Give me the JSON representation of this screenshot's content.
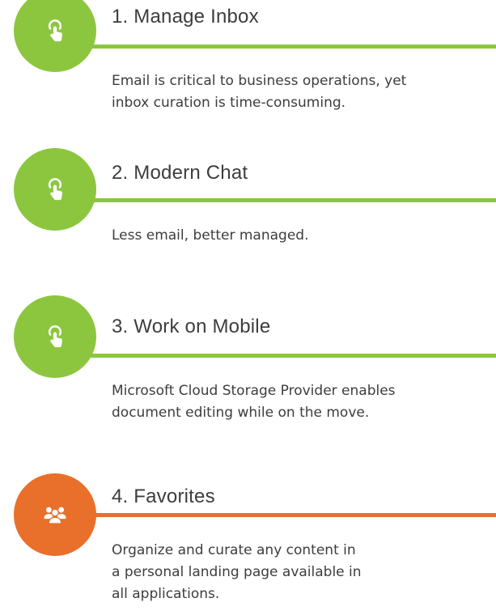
{
  "items": [
    {
      "number": "1.",
      "title": "Manage Inbox",
      "icon": "touch-hand-icon",
      "color": "#8cc63f",
      "description_lines": [
        "Email is critical to business operations, yet",
        "inbox curation is time-consuming."
      ]
    },
    {
      "number": "2.",
      "title": "Modern Chat",
      "icon": "touch-hand-icon",
      "color": "#8cc63f",
      "description_lines": [
        "Less email, better managed."
      ]
    },
    {
      "number": "3.",
      "title": "Work on Mobile",
      "icon": "touch-hand-icon",
      "color": "#8cc63f",
      "description_lines": [
        "Microsoft Cloud Storage Provider enables",
        "document editing while on the move."
      ]
    },
    {
      "number": "4.",
      "title": "Favorites",
      "icon": "users-group-icon",
      "color": "#e8702a",
      "description_lines": [
        "Organize and curate any content in",
        "a personal landing page available in",
        "all applications."
      ]
    }
  ]
}
